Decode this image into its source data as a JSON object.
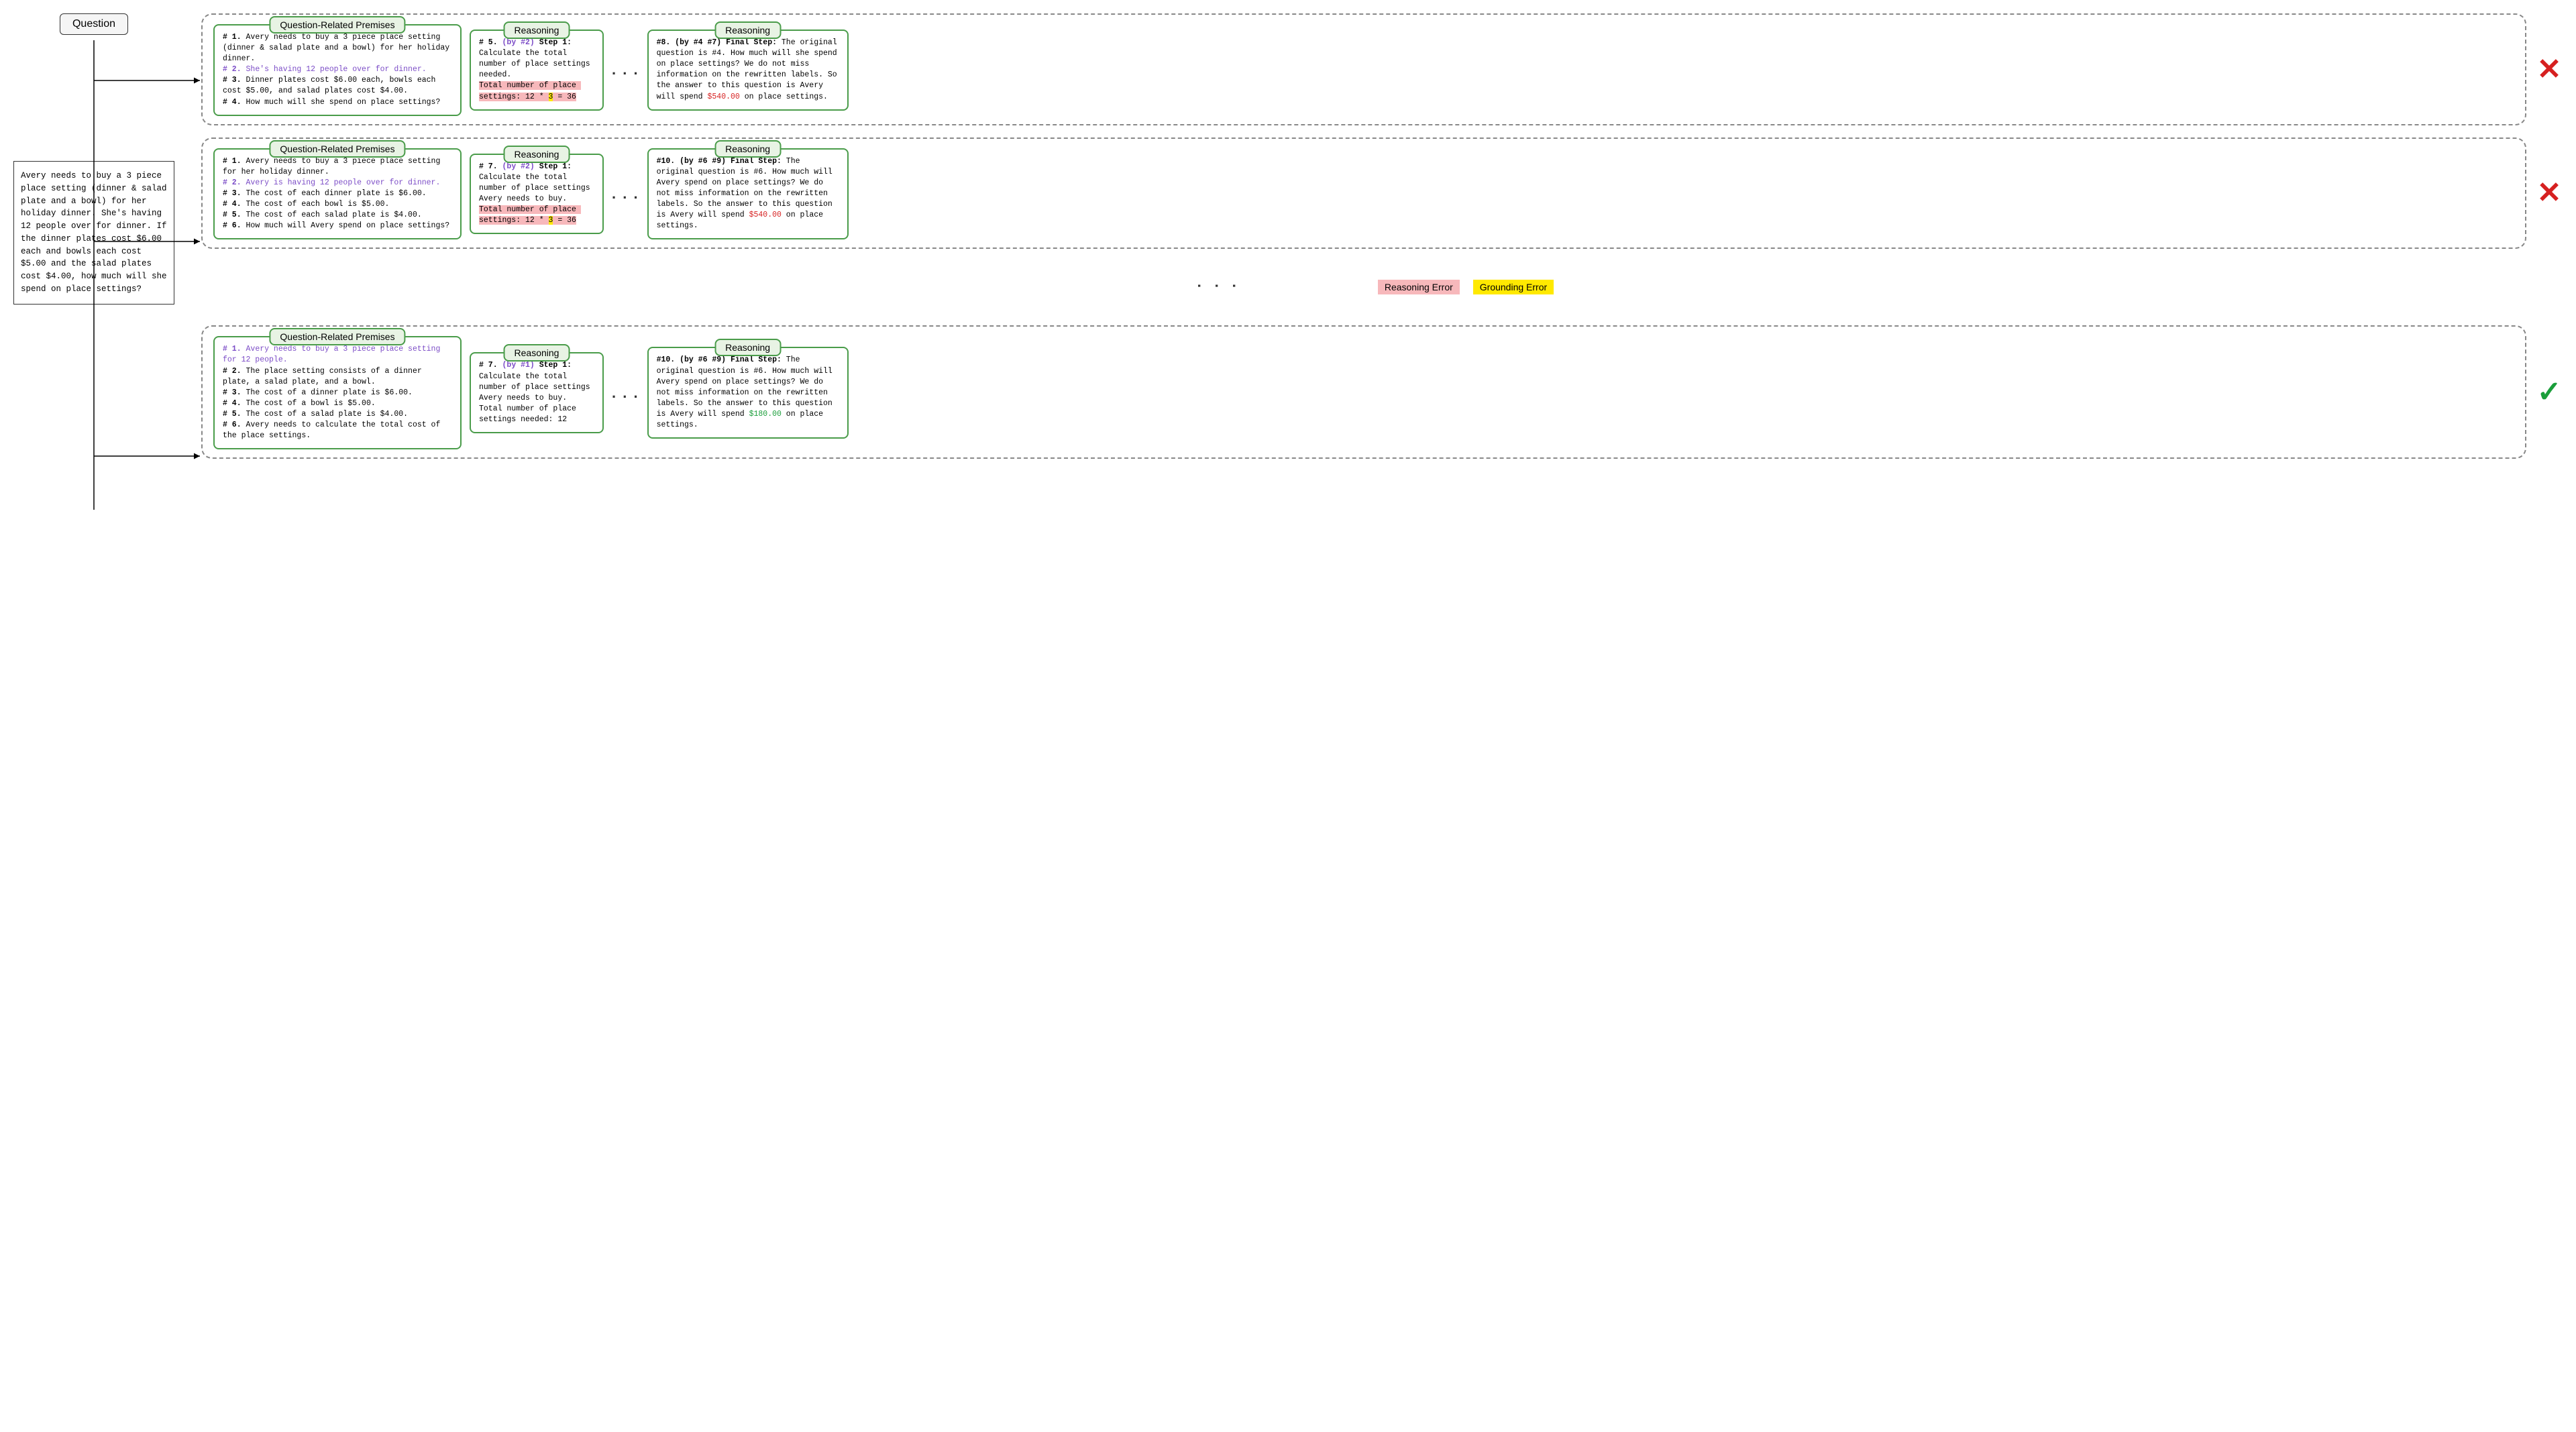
{
  "labels": {
    "question_label": "Question",
    "premises_title": "Question-Related Premises",
    "reasoning_title": "Reasoning",
    "ellipsis": ". . .",
    "vellipsis": ". . .",
    "legend_reasoning_error": "Reasoning Error",
    "legend_grounding_error": "Grounding Error",
    "mark_x": "✕",
    "mark_check": "✓"
  },
  "question_text": "Avery needs to buy a 3 piece place setting (dinner & salad plate and a bowl) for her holiday dinner.  She's having 12 people over for dinner.  If the dinner plates cost $6.00 each and bowls each cost $5.00 and the salad plates cost $4.00, how much will she spend on place settings?",
  "paths": [
    {
      "premises": {
        "lines": [
          {
            "bold": true,
            "text": "# 1."
          },
          {
            "text": " Avery needs to buy a 3 piece place setting (dinner & salad plate and a bowl) for her holiday dinner."
          },
          {
            "br": true
          },
          {
            "bold": true,
            "purple": true,
            "text": "# 2."
          },
          {
            "purple": true,
            "text": " She's having 12 people over for dinner."
          },
          {
            "br": true
          },
          {
            "bold": true,
            "text": "# 3."
          },
          {
            "text": " Dinner plates cost $6.00 each, bowls each cost $5.00, and salad plates cost $4.00."
          },
          {
            "br": true
          },
          {
            "bold": true,
            "text": "# 4."
          },
          {
            "text": " How much will she spend on place settings?"
          }
        ]
      },
      "reasoning1": {
        "lines": [
          {
            "bold": true,
            "text": "# 5. "
          },
          {
            "bold": true,
            "purple": true,
            "text": "(by #2)"
          },
          {
            "bold": true,
            "text": " Step 1:"
          },
          {
            "br": true
          },
          {
            "text": "Calculate the total number of place settings needed."
          },
          {
            "br": true
          },
          {
            "hl": "pink",
            "text": "Total number of place settings: 12 * "
          },
          {
            "hl": "yellow",
            "text": "3"
          },
          {
            "hl": "pink",
            "text": " = 36"
          }
        ]
      },
      "reasoning2": {
        "lines": [
          {
            "bold": true,
            "text": "#8. (by #4 #7) Final Step:"
          },
          {
            "text": " The original question is #4. How much will she spend on place settings? We do not miss information on the rewritten labels. So the answer to this question is Avery will spend "
          },
          {
            "red": true,
            "text": "$540.00"
          },
          {
            "text": " on place settings."
          }
        ]
      },
      "mark": "x"
    },
    {
      "premises": {
        "lines": [
          {
            "bold": true,
            "text": "# 1."
          },
          {
            "text": " Avery needs to buy a 3 piece place setting for her holiday dinner."
          },
          {
            "br": true
          },
          {
            "bold": true,
            "purple": true,
            "text": "# 2."
          },
          {
            "purple": true,
            "text": " Avery is having 12 people over for dinner."
          },
          {
            "br": true
          },
          {
            "bold": true,
            "text": "# 3."
          },
          {
            "text": " The cost of each dinner plate is $6.00."
          },
          {
            "br": true
          },
          {
            "bold": true,
            "text": "# 4."
          },
          {
            "text": " The cost of each bowl is $5.00."
          },
          {
            "br": true
          },
          {
            "bold": true,
            "text": "# 5."
          },
          {
            "text": " The cost of each salad plate is $4.00."
          },
          {
            "br": true
          },
          {
            "bold": true,
            "text": "# 6."
          },
          {
            "text": " How much will Avery spend on place settings?"
          }
        ]
      },
      "reasoning1": {
        "lines": [
          {
            "bold": true,
            "text": "# 7. "
          },
          {
            "bold": true,
            "purple": true,
            "text": "(by #2)"
          },
          {
            "bold": true,
            "text": " Step 1:"
          },
          {
            "br": true
          },
          {
            "text": "Calculate the total number of place settings Avery needs to buy. "
          },
          {
            "hl": "pink",
            "text": "Total number of place settings: 12 * "
          },
          {
            "hl": "yellow",
            "text": "3"
          },
          {
            "hl": "pink",
            "text": " = 36"
          }
        ]
      },
      "reasoning2": {
        "lines": [
          {
            "bold": true,
            "text": "#10. (by #6 #9) Final Step:"
          },
          {
            "text": " The original question is #6. How much will Avery spend on place settings? We do not miss information on the rewritten labels. So the answer to this question is Avery will spend "
          },
          {
            "red": true,
            "text": "$540.00"
          },
          {
            "text": " on place settings."
          }
        ]
      },
      "mark": "x"
    },
    {
      "premises": {
        "lines": [
          {
            "bold": true,
            "purple": true,
            "text": "# 1."
          },
          {
            "purple": true,
            "text": " Avery needs to buy a 3 piece place setting for 12 people."
          },
          {
            "br": true
          },
          {
            "bold": true,
            "text": "# 2."
          },
          {
            "text": " The place setting consists of a dinner plate, a salad plate, and a bowl."
          },
          {
            "br": true
          },
          {
            "bold": true,
            "text": "# 3."
          },
          {
            "text": " The cost of a dinner plate is $6.00."
          },
          {
            "br": true
          },
          {
            "bold": true,
            "text": "# 4."
          },
          {
            "text": " The cost of a bowl is $5.00."
          },
          {
            "br": true
          },
          {
            "bold": true,
            "text": "# 5."
          },
          {
            "text": " The cost of a salad plate is $4.00."
          },
          {
            "br": true
          },
          {
            "bold": true,
            "text": "# 6."
          },
          {
            "text": " Avery needs to calculate the total cost of the place settings."
          }
        ]
      },
      "reasoning1": {
        "lines": [
          {
            "bold": true,
            "text": "# 7. "
          },
          {
            "bold": true,
            "purple": true,
            "text": "(by #1)"
          },
          {
            "bold": true,
            "text": " Step 1:"
          },
          {
            "br": true
          },
          {
            "text": "Calculate the total number of place settings Avery needs to buy. Total number of place settings needed: 12"
          }
        ]
      },
      "reasoning2": {
        "lines": [
          {
            "bold": true,
            "text": "#10. (by #6 #9) Final Step:"
          },
          {
            "text": " The original question is #6. How much will Avery spend on place settings? We do not miss information on the rewritten labels. So the answer to this question is Avery will spend "
          },
          {
            "green": true,
            "text": "$180.00"
          },
          {
            "text": " on place settings."
          }
        ]
      },
      "mark": "check"
    }
  ]
}
